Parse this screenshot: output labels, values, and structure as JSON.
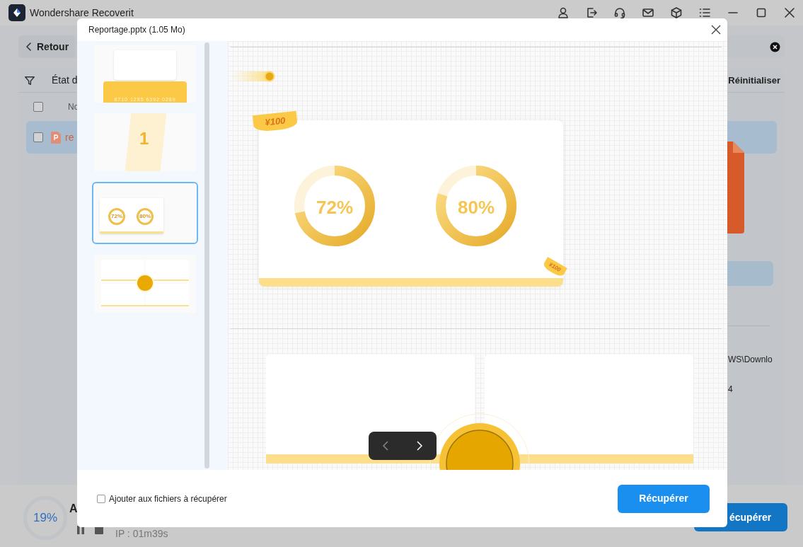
{
  "app": {
    "title": "Wondershare Recoverit",
    "back": "Retour",
    "filter_label": "État d",
    "reset": "Réinitialiser",
    "list_header": "No",
    "select_all_checked": false,
    "file_row": {
      "name": "re",
      "checked": false,
      "selected": true
    },
    "path": "WS\\Downlo",
    "size": "4",
    "progress": "19%",
    "status_label": "A",
    "elapsed": "IP : 01m39s",
    "recover": "écupérer"
  },
  "dialog": {
    "title": "Reportage.pptx (1.05 Mo)",
    "thumbnails": [
      {
        "kind": "card",
        "selected": false,
        "texts": [
          "8710 1285 6392 0289"
        ]
      },
      {
        "kind": "number",
        "selected": false,
        "texts": [
          "1"
        ]
      },
      {
        "kind": "chart",
        "selected": true,
        "texts": [
          "72%",
          "80%"
        ]
      },
      {
        "kind": "grid",
        "selected": false
      }
    ],
    "slide": {
      "ribbon": "¥100",
      "corner_ribbon": "¥100",
      "rings": [
        {
          "reading": "72%",
          "level": 0.72
        },
        {
          "reading": "80%",
          "level": 0.8
        }
      ]
    },
    "add_checkbox": {
      "label": "Ajouter aux fichiers à récupérer",
      "checked": false
    },
    "recover": "Récupérer"
  }
}
